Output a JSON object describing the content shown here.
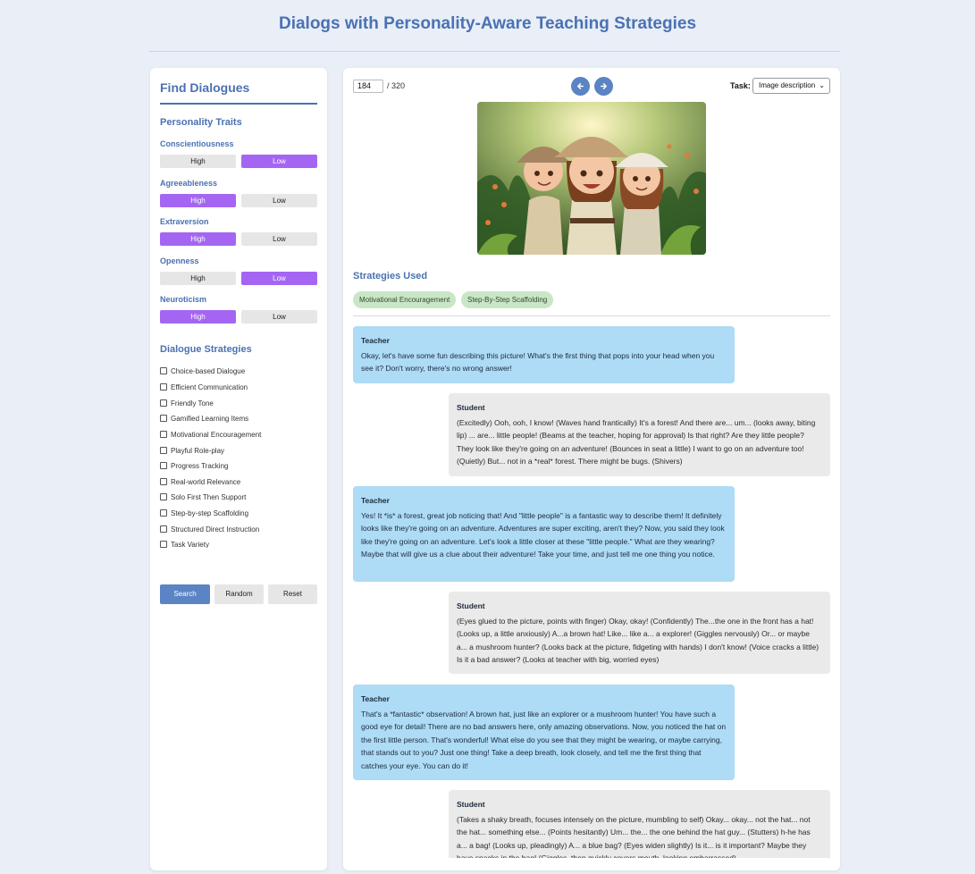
{
  "page": {
    "title": "Dialogs with Personality-Aware Teaching Strategies"
  },
  "sidebar": {
    "title": "Find Dialogues",
    "traits_title": "Personality Traits",
    "traits": [
      {
        "name": "Conscientiousness",
        "high": "High",
        "low": "Low",
        "selected": "Low"
      },
      {
        "name": "Agreeableness",
        "high": "High",
        "low": "Low",
        "selected": "High"
      },
      {
        "name": "Extraversion",
        "high": "High",
        "low": "Low",
        "selected": "High"
      },
      {
        "name": "Openness",
        "high": "High",
        "low": "Low",
        "selected": "Low"
      },
      {
        "name": "Neuroticism",
        "high": "High",
        "low": "Low",
        "selected": "High"
      }
    ],
    "strategies_title": "Dialogue Strategies",
    "strategies": [
      "Choice-based Dialogue",
      "Efficient Communication",
      "Friendly Tone",
      "Gamified Learning Items",
      "Motivational Encouragement",
      "Playful Role-play",
      "Progress Tracking",
      "Real-world Relevance",
      "Solo First Then Support",
      "Step-by-step Scaffolding",
      "Structured Direct Instruction",
      "Task Variety"
    ],
    "buttons": {
      "search": "Search",
      "random": "Random",
      "reset": "Reset"
    }
  },
  "main": {
    "current_index": "184",
    "total": "/ 320",
    "task_label": "Task:",
    "task_value": "Image description",
    "strategies_title": "Strategies Used",
    "strategies_used": [
      "Motivational Encouragement",
      "Step-By-Step Scaffolding"
    ],
    "dialogue": [
      {
        "speaker": "Teacher",
        "text": "Okay, let's have some fun describing this picture! What's the first thing that pops into your head when you see it? Don't worry, there's no wrong answer!"
      },
      {
        "speaker": "Student",
        "text": "(Excitedly) Ooh, ooh, I know! (Waves hand frantically) It's a forest! And there are... um... (looks away, biting lip) ... are... little people! (Beams at the teacher, hoping for approval) Is that right? Are they little people? They look like they're going on an adventure! (Bounces in seat a little) I want to go on an adventure too! (Quietly) But... not in a *real* forest. There might be bugs. (Shivers)"
      },
      {
        "speaker": "Teacher",
        "text": "Yes! It *is* a forest, great job noticing that! And \"little people\" is a fantastic way to describe them! It definitely looks like they're going on an adventure. Adventures are super exciting, aren't they? Now, you said they look like they're going on an adventure. Let's look a little closer at these \"little people.\" What are they wearing? Maybe that will give us a clue about their adventure! Take your time, and just tell me one thing you notice."
      },
      {
        "speaker": "Student",
        "text": "(Eyes glued to the picture, points with finger) Okay, okay! (Confidently) The...the one in the front has a hat! (Looks up, a little anxiously) A...a brown hat! Like... like a... a explorer! (Giggles nervously) Or... or maybe a... a mushroom hunter? (Looks back at the picture, fidgeting with hands) I don't know! (Voice cracks a little) Is it a bad answer? (Looks at teacher with big, worried eyes)"
      },
      {
        "speaker": "Teacher",
        "text": "That's a *fantastic* observation! A brown hat, just like an explorer or a mushroom hunter! You have such a good eye for detail! There are no bad answers here, only amazing observations. Now, you noticed the hat on the first little person. That's wonderful! What else do you see that they might be wearing, or maybe carrying, that stands out to you? Just one thing! Take a deep breath, look closely, and tell me the first thing that catches your eye. You can do it!"
      },
      {
        "speaker": "Student",
        "text": "(Takes a shaky breath, focuses intensely on the picture, mumbling to self) Okay... okay... not the hat... not the hat... something else... (Points hesitantly) Um... the... the one behind the hat guy... (Stutters) h-he has a... a bag! (Looks up, pleadingly) A... a blue bag? (Eyes widen slightly) Is it... is it important? Maybe they have snacks in the bag! (Giggles, then quickly covers mouth, looking embarrassed)"
      }
    ]
  },
  "colors": {
    "accent": "#4a72b2",
    "selected_trait": "#a466f2",
    "teacher_bubble": "#aedbf5",
    "student_bubble": "#eaeaea",
    "tag": "#c9e7c7",
    "background": "#e9eef7"
  },
  "icons": {
    "prev": "arrow-left-icon",
    "next": "arrow-right-icon",
    "select": "chevron-down-icon"
  }
}
